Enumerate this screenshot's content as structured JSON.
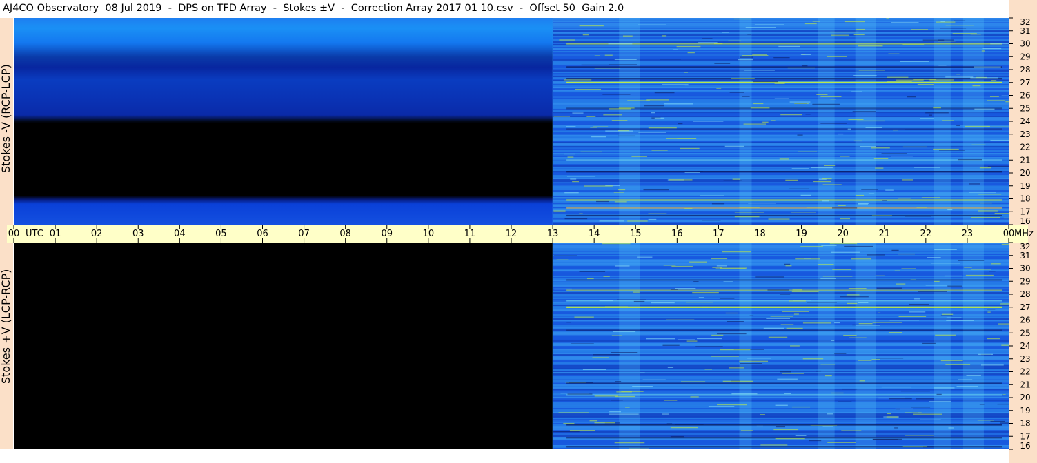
{
  "title": "AJ4CO Observatory  08 Jul 2019  -  DPS on TFD Array  -  Stokes ±V  -  Correction Array 2017 01 10.csv  -  Offset 50  Gain 2.0",
  "colors": {
    "background": "#ffffff",
    "axis_band": "#ffffc8",
    "side_strip": "#fbe0c8",
    "no_data": "#000000",
    "spectrum_base": "#1e64e6",
    "spectrum_light": "#3caaf0",
    "spectrum_hot": "#c8f03c",
    "spectrum_dark": "#0a1a60"
  },
  "chart_data": [
    {
      "type": "heatmap",
      "panel": "top",
      "ylabel": "Stokes -V (RCP-LCP)",
      "x_unit": "UTC",
      "y_unit": "MHz",
      "x_range": [
        0,
        24
      ],
      "y_range": [
        16,
        32
      ],
      "x_tick_labels": [
        "00",
        "01",
        "02",
        "03",
        "04",
        "05",
        "06",
        "07",
        "08",
        "09",
        "10",
        "11",
        "12",
        "13",
        "14",
        "15",
        "16",
        "17",
        "18",
        "19",
        "20",
        "21",
        "22",
        "23",
        "00"
      ],
      "y_tick_labels": [
        "16",
        "17",
        "18",
        "19",
        "20",
        "21",
        "22",
        "23",
        "24",
        "25",
        "26",
        "27",
        "28",
        "29",
        "30",
        "31",
        "32"
      ],
      "data_start_utc": 13,
      "notes": "Before 13 UTC a smooth calibration-style blue gradient with no data (black) between ~17.8 and ~24 MHz; after 13 UTC a noisy spectrum with bright emission bands near 17, 18, 20, 27 and 30 MHz."
    },
    {
      "type": "heatmap",
      "panel": "bottom",
      "ylabel": "Stokes +V (LCP-RCP)",
      "x_unit": "UTC",
      "y_unit": "MHz",
      "x_range": [
        0,
        24
      ],
      "y_range": [
        16,
        32
      ],
      "y_tick_labels": [
        "16",
        "17",
        "18",
        "19",
        "20",
        "21",
        "22",
        "23",
        "24",
        "25",
        "26",
        "27",
        "28",
        "29",
        "30",
        "31",
        "32"
      ],
      "data_start_utc": 13,
      "notes": "No data (black) before 13 UTC; after 13 UTC noisy spectrum with a bright emission band near 27 MHz."
    }
  ],
  "axis": {
    "utc_label": "UTC",
    "mhz_label": "MHz"
  }
}
